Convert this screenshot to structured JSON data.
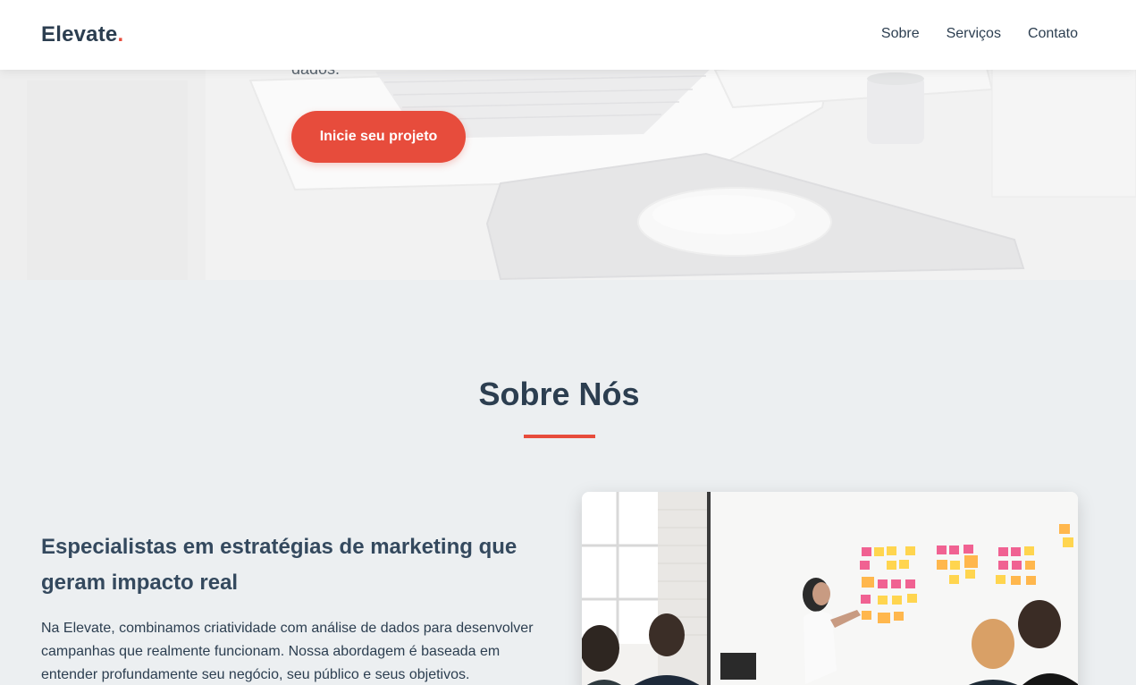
{
  "header": {
    "logo_text": "Elevate",
    "logo_dot": ".",
    "nav": [
      {
        "label": "Sobre"
      },
      {
        "label": "Serviços"
      },
      {
        "label": "Contato"
      }
    ]
  },
  "hero": {
    "text_fragment": "dados.",
    "cta_label": "Inicie seu projeto"
  },
  "about": {
    "title": "Sobre Nós",
    "heading": "Especialistas em estratégias de marketing que geram impacto real",
    "paragraph": "Na Elevate, combinamos criatividade com análise de dados para desenvolver campanhas que realmente funcionam. Nossa abordagem é baseada em entender profundamente seu negócio, seu público e seus objetivos."
  },
  "colors": {
    "accent": "#e74c3c",
    "text_dark": "#2c3e50",
    "section_bg": "#eceff1"
  },
  "icons": {
    "hero_photo": "laptop-desk-photo",
    "about_photo": "team-meeting-sticky-notes-photo"
  }
}
